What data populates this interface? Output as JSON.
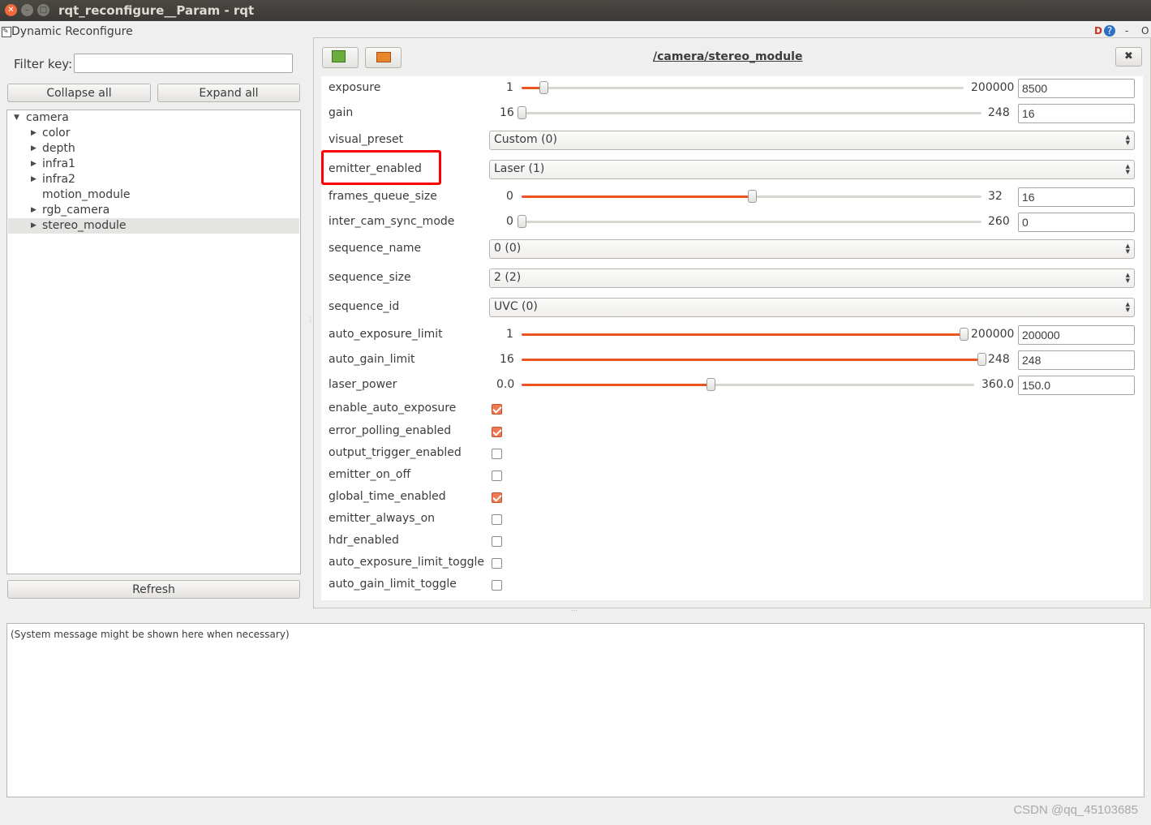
{
  "window": {
    "title": "rqt_reconfigure__Param - rqt"
  },
  "plugin": {
    "title": "Dynamic Reconfigure",
    "header_icons": [
      "D",
      "?",
      "-",
      "O"
    ]
  },
  "filter": {
    "label": "Filter key:",
    "value": ""
  },
  "buttons": {
    "collapse": "Collapse all",
    "expand": "Expand all",
    "refresh": "Refresh"
  },
  "tree": {
    "root": "camera",
    "items": [
      {
        "label": "color",
        "expandable": true
      },
      {
        "label": "depth",
        "expandable": true
      },
      {
        "label": "infra1",
        "expandable": true
      },
      {
        "label": "infra2",
        "expandable": true
      },
      {
        "label": "motion_module",
        "expandable": false
      },
      {
        "label": "rgb_camera",
        "expandable": true
      },
      {
        "label": "stereo_module",
        "expandable": true,
        "selected": true
      }
    ]
  },
  "panel": {
    "title": "/camera/stereo_module",
    "close": "✖"
  },
  "params": {
    "exposure": {
      "name": "exposure",
      "min": "1",
      "max": "200000",
      "value": "8500",
      "frac": 0.05
    },
    "gain": {
      "name": "gain",
      "min": "16",
      "max": "248",
      "value": "16",
      "frac": 0.0
    },
    "visual_preset": {
      "name": "visual_preset",
      "value": "Custom (0)"
    },
    "emitter_enabled": {
      "name": "emitter_enabled",
      "value": "Laser (1)"
    },
    "frames_queue_size": {
      "name": "frames_queue_size",
      "min": "0",
      "max": "32",
      "value": "16",
      "frac": 0.5
    },
    "inter_cam_sync_mode": {
      "name": "inter_cam_sync_mode",
      "min": "0",
      "max": "260",
      "value": "0",
      "frac": 0.0
    },
    "sequence_name": {
      "name": "sequence_name",
      "value": "0 (0)"
    },
    "sequence_size": {
      "name": "sequence_size",
      "value": "2 (2)"
    },
    "sequence_id": {
      "name": "sequence_id",
      "value": "UVC (0)"
    },
    "auto_exposure_limit": {
      "name": "auto_exposure_limit",
      "min": "1",
      "max": "200000",
      "value": "200000",
      "frac": 1.0
    },
    "auto_gain_limit": {
      "name": "auto_gain_limit",
      "min": "16",
      "max": "248",
      "value": "248",
      "frac": 1.0
    },
    "laser_power": {
      "name": "laser_power",
      "min": "0.0",
      "max": "360.0",
      "value": "150.0",
      "frac": 0.4167
    },
    "enable_auto_exposure": {
      "name": "enable_auto_exposure",
      "checked": true
    },
    "error_polling_enabled": {
      "name": "error_polling_enabled",
      "checked": true
    },
    "output_trigger_enabled": {
      "name": "output_trigger_enabled",
      "checked": false
    },
    "emitter_on_off": {
      "name": "emitter_on_off",
      "checked": false
    },
    "global_time_enabled": {
      "name": "global_time_enabled",
      "checked": true
    },
    "emitter_always_on": {
      "name": "emitter_always_on",
      "checked": false
    },
    "hdr_enabled": {
      "name": "hdr_enabled",
      "checked": false
    },
    "auto_exposure_limit_toggle": {
      "name": "auto_exposure_limit_toggle",
      "checked": false
    },
    "auto_gain_limit_toggle": {
      "name": "auto_gain_limit_toggle",
      "checked": false
    }
  },
  "system_message": "(System message might be shown here when necessary)",
  "watermark": "CSDN @qq_45103685",
  "colors": {
    "accent": "#e95420",
    "highlight": "#ff0000",
    "titlebar": "#3b3a36"
  }
}
